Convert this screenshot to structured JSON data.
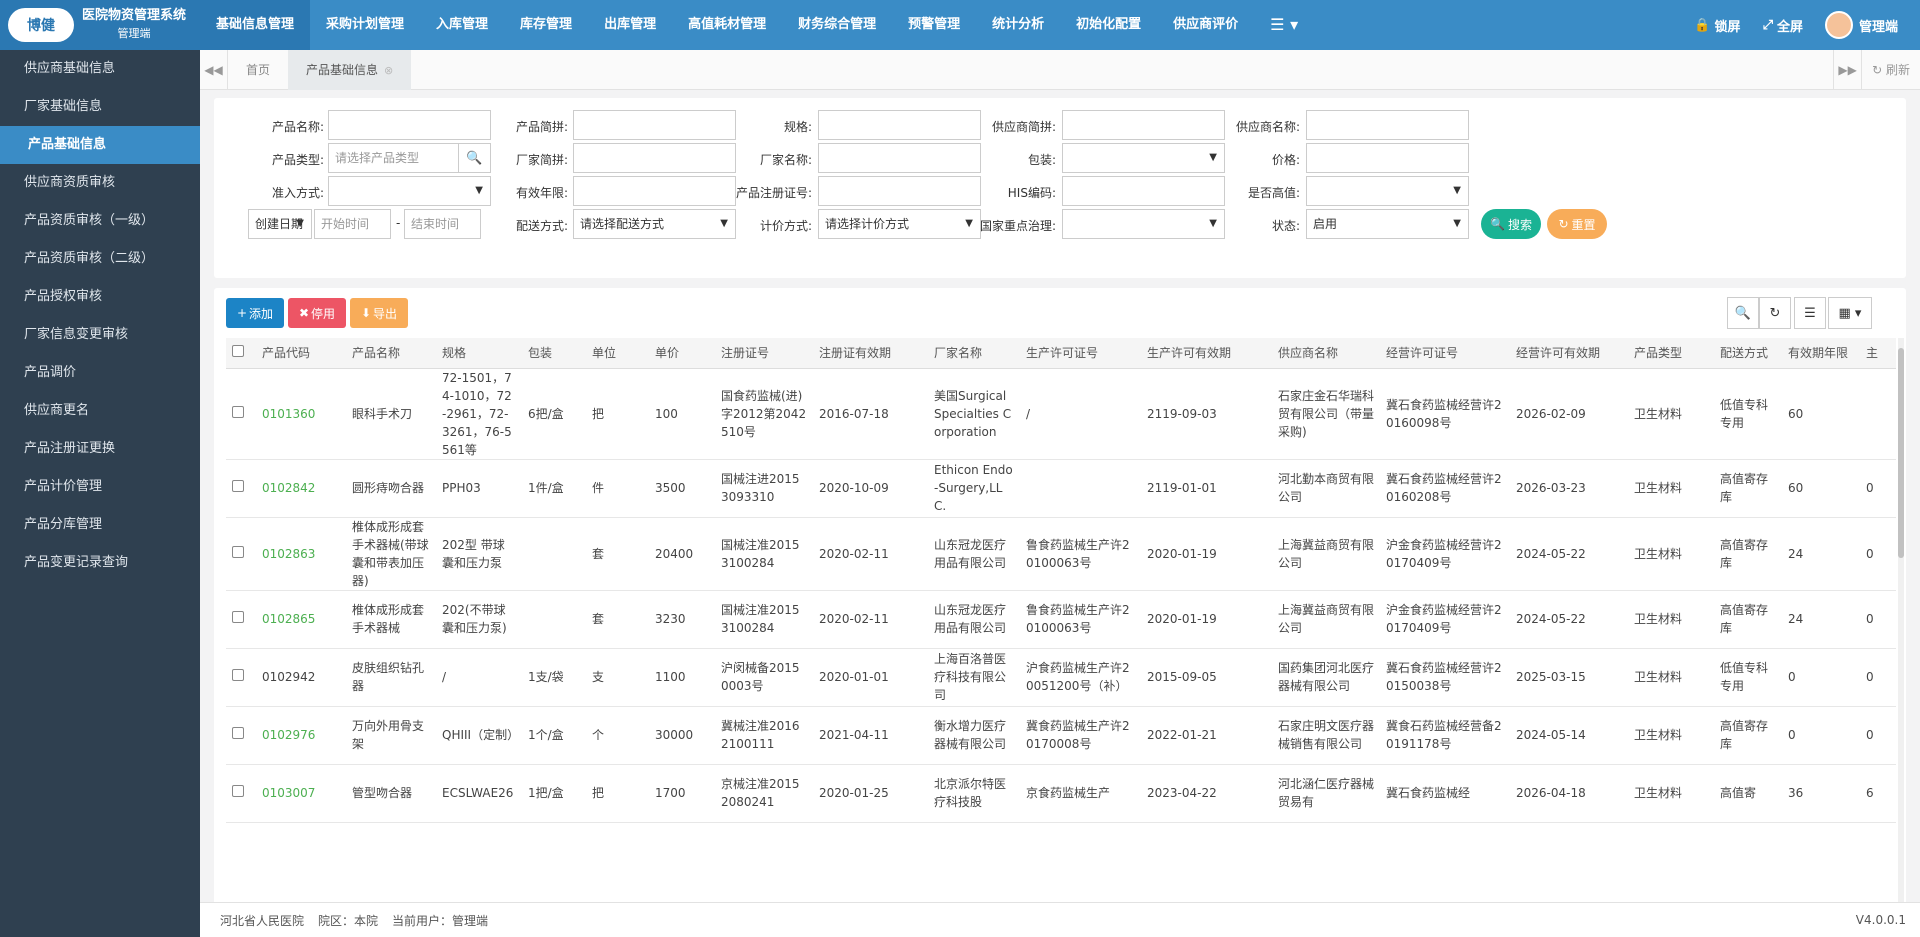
{
  "app": {
    "logo_text": "博健",
    "title": "医院物资管理系统",
    "subtitle": "管理端"
  },
  "nav": [
    "基础信息管理",
    "采购计划管理",
    "入库管理",
    "库存管理",
    "出库管理",
    "高值耗材管理",
    "财务综合管理",
    "预警管理",
    "统计分析",
    "初始化配置",
    "供应商评价"
  ],
  "top_right": {
    "lock": "锁屏",
    "fullscreen": "全屏",
    "user": "管理端"
  },
  "sidebar": [
    "供应商基础信息",
    "厂家基础信息",
    "产品基础信息",
    "供应商资质审核",
    "产品资质审核（一级）",
    "产品资质审核（二级）",
    "产品授权审核",
    "厂家信息变更审核",
    "产品调价",
    "供应商更名",
    "产品注册证更换",
    "产品计价管理",
    "产品分库管理",
    "产品变更记录查询"
  ],
  "tabs": {
    "home": "首页",
    "current": "产品基础信息",
    "refresh": "刷新"
  },
  "filters": {
    "name": "产品名称:",
    "pinyin": "产品简拼:",
    "spec": "规格:",
    "supplier_pinyin": "供应商简拼:",
    "supplier_name": "供应商名称:",
    "type": "产品类型:",
    "type_ph": "请选择产品类型",
    "maker_pinyin": "厂家简拼:",
    "maker_name": "厂家名称:",
    "pack": "包装:",
    "price": "价格:",
    "access": "准入方式:",
    "valid_years": "有效年限:",
    "reg_no": "产品注册证号:",
    "his": "HIS编码:",
    "high_value": "是否高值:",
    "date_type": "创建日期",
    "start_ph": "开始时间",
    "dash": "-",
    "end_ph": "结束时间",
    "delivery": "配送方式:",
    "delivery_ph": "请选择配送方式",
    "pricing": "计价方式:",
    "pricing_ph": "请选择计价方式",
    "national": "国家重点治理:",
    "status": "状态:",
    "status_val": "启用",
    "search_btn": "搜索",
    "reset_btn": "重置"
  },
  "toolbar": {
    "add": "添加",
    "disable": "停用",
    "export": "导出"
  },
  "columns": [
    "产品代码",
    "产品名称",
    "规格",
    "包装",
    "单位",
    "单价",
    "注册证号",
    "注册证有效期",
    "厂家名称",
    "生产许可证号",
    "生产许可有效期",
    "供应商名称",
    "经营许可证号",
    "经营许可有效期",
    "产品类型",
    "配送方式",
    "有效期年限",
    "主"
  ],
  "rows": [
    [
      "0101360",
      "眼科手术刀",
      "72-1501，74-1010，72-2961，72-3261，76-5561等",
      "6把/盒",
      "把",
      "100",
      "国食药监械(进)字2012第2042510号",
      "2016-07-18",
      "美国Surgical Specialties Corporation",
      "/",
      "2119-09-03",
      "石家庄金石华瑞科贸有限公司（带量采购)",
      "冀石食药监械经营许20160098号",
      "2026-02-09",
      "卫生材料",
      "低值专科专用",
      "60",
      ""
    ],
    [
      "0102842",
      "圆形痔吻合器",
      "PPH03",
      "1件/盒",
      "件",
      "3500",
      "国械注进20153093310",
      "2020-10-09",
      "Ethicon Endo-Surgery,LLC.",
      "",
      "2119-01-01",
      "河北勤本商贸有限公司",
      "冀石食药监械经营许20160208号",
      "2026-03-23",
      "卫生材料",
      "高值寄存库",
      "60",
      "0"
    ],
    [
      "0102863",
      "椎体成形成套手术器械(带球囊和带表加压器)",
      "202型 带球囊和压力泵",
      "",
      "套",
      "20400",
      "国械注准20153100284",
      "2020-02-11",
      "山东冠龙医疗用品有限公司",
      "鲁食药监械生产许20100063号",
      "2020-01-19",
      "上海冀益商贸有限公司",
      "沪金食药监械经营许20170409号",
      "2024-05-22",
      "卫生材料",
      "高值寄存库",
      "24",
      "0"
    ],
    [
      "0102865",
      "椎体成形成套手术器械",
      "202(不带球囊和压力泵)",
      "",
      "套",
      "3230",
      "国械注准20153100284",
      "2020-02-11",
      "山东冠龙医疗用品有限公司",
      "鲁食药监械生产许20100063号",
      "2020-01-19",
      "上海冀益商贸有限公司",
      "沪金食药监械经营许20170409号",
      "2024-05-22",
      "卫生材料",
      "高值寄存库",
      "24",
      "0"
    ],
    [
      "0102942",
      "皮肤组织钻孔器",
      "/",
      "1支/袋",
      "支",
      "1100",
      "沪闵械备20150003号",
      "2020-01-01",
      "上海百洛普医疗科技有限公司",
      "沪食药监械生产许20051200号（补）",
      "2015-09-05",
      "国药集团河北医疗器械有限公司",
      "冀石食药监械经营许20150038号",
      "2025-03-15",
      "卫生材料",
      "低值专科专用",
      "0",
      "0"
    ],
    [
      "0102976",
      "万向外用骨支架",
      "QHIII（定制）",
      "1个/盒",
      "个",
      "30000",
      "冀械注准20162100111",
      "2021-04-11",
      "衡水增力医疗器械有限公司",
      "冀食药监械生产许20170008号",
      "2022-01-21",
      "石家庄明文医疗器械销售有限公司",
      "冀食石药监械经营备20191178号",
      "2024-05-14",
      "卫生材料",
      "高值寄存库",
      "0",
      "0"
    ],
    [
      "0103007",
      "管型吻合器",
      "ECSLWAE26",
      "1把/盒",
      "把",
      "1700",
      "京械注准20152080241",
      "2020-01-25",
      "北京派尔特医疗科技股",
      "京食药监械生产",
      "2023-04-22",
      "河北涵仁医疗器械贸易有",
      "冀石食药监械经",
      "2026-04-18",
      "卫生材料",
      "高值寄",
      "36",
      "6"
    ]
  ],
  "footer": {
    "hospital": "河北省人民医院",
    "area": "院区：本院",
    "user": "当前用户：管理端",
    "version": "V4.0.0.1"
  }
}
